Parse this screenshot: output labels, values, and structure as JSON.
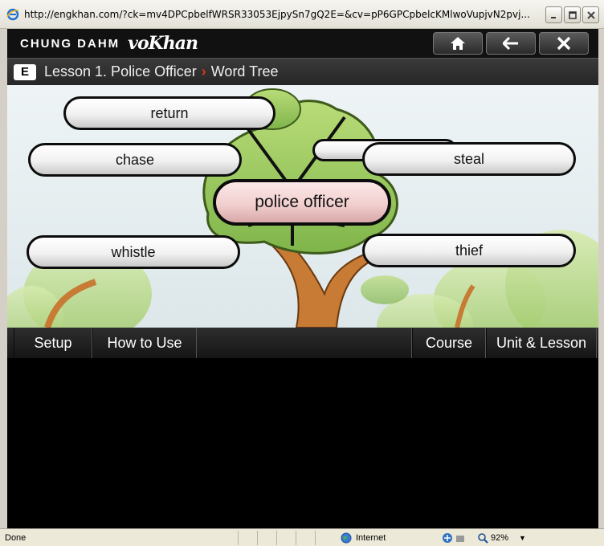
{
  "window": {
    "title": "http://engkhan.com/?ck=mv4DPCpbelfWRSR33053EjpySn7gQ2E=&cv=pP6GPCpbelcKMlwoVupjvN2pvj...",
    "controls": [
      "minimize",
      "maximize",
      "close"
    ]
  },
  "app": {
    "brand": "CHUNG DAHM",
    "brand_script": "voKhan",
    "nav": [
      "home-icon",
      "back-arrow-icon",
      "close-icon"
    ]
  },
  "lesson": {
    "level": "E",
    "title": "Lesson 1. Police Officer",
    "separator": "›",
    "activity": "Word Tree"
  },
  "word_tree": {
    "center": "police officer",
    "words": [
      "return",
      "chase",
      "steal",
      "whistle",
      "thief"
    ]
  },
  "menu": {
    "left": [
      "Setup",
      "How to Use"
    ],
    "right": [
      "Course",
      "Unit & Lesson"
    ]
  },
  "status": {
    "text": "Done",
    "zone": "Internet",
    "zoom": "92%"
  },
  "colors": {
    "accent": "#e0331f",
    "center_bubble": "#f2cfcf",
    "word_bubble": "#f1f1f1"
  }
}
